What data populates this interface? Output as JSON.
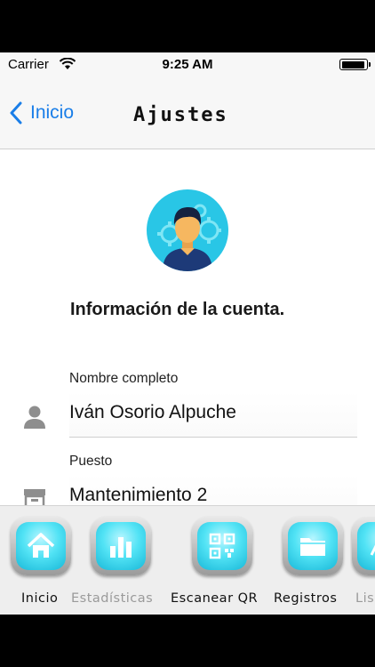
{
  "status_bar": {
    "carrier": "Carrier",
    "time": "9:25 AM"
  },
  "nav": {
    "back_label": "Inicio",
    "title": "Ajustes"
  },
  "section_title": "Información de la cuenta.",
  "fields": [
    {
      "label": "Nombre completo",
      "value": "Iván Osorio Alpuche",
      "icon": "person-icon"
    },
    {
      "label": "Puesto",
      "value": "Mantenimiento 2",
      "icon": "archive-box-icon"
    }
  ],
  "tabs": [
    {
      "label": "Inicio",
      "icon": "home-icon"
    },
    {
      "label": "Estadísticas",
      "icon": "bar-chart-icon"
    },
    {
      "label": "Escanear QR",
      "icon": "qr-code-icon"
    },
    {
      "label": "Registros",
      "icon": "folder-icon"
    },
    {
      "label": "Lis",
      "icon": "list-icon"
    }
  ],
  "colors": {
    "accent": "#1a7ee8",
    "tab_glow": "#52e3f5",
    "avatar_bg": "#29c6e6"
  }
}
